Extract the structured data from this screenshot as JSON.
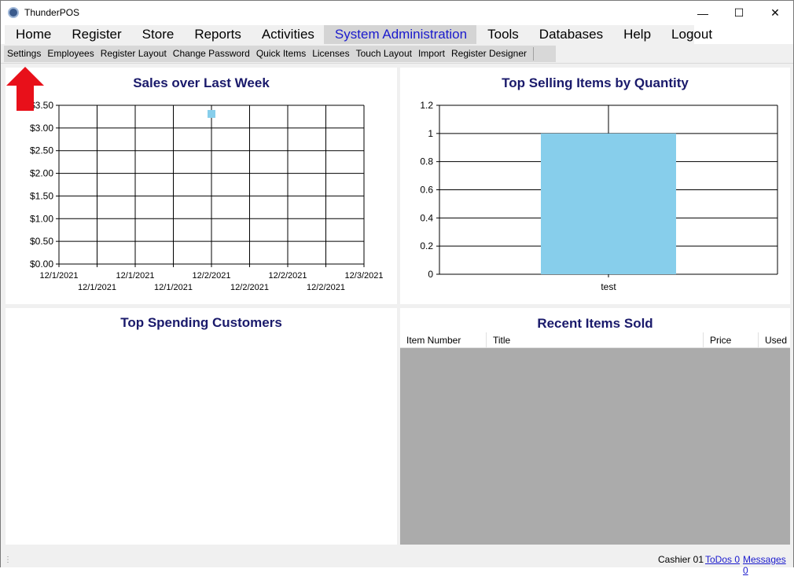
{
  "window": {
    "title": "ThunderPOS",
    "minimize": "—",
    "maximize": "☐",
    "close": "✕"
  },
  "menubar": {
    "items": [
      {
        "label": "Home"
      },
      {
        "label": "Register"
      },
      {
        "label": "Store"
      },
      {
        "label": "Reports"
      },
      {
        "label": "Activities"
      },
      {
        "label": "System Administration",
        "active": true
      },
      {
        "label": "Tools"
      },
      {
        "label": "Databases"
      },
      {
        "label": "Help"
      },
      {
        "label": "Logout"
      }
    ]
  },
  "toolbar": {
    "items": [
      {
        "label": "Settings"
      },
      {
        "label": "Employees"
      },
      {
        "label": "Register Layout"
      },
      {
        "label": "Change Password"
      },
      {
        "label": "Quick Items"
      },
      {
        "label": "Licenses"
      },
      {
        "label": "Touch Layout"
      },
      {
        "label": "Import"
      },
      {
        "label": "Register Designer"
      }
    ]
  },
  "sales_panel": {
    "title": "Sales over Last Week"
  },
  "top_items_panel": {
    "title": "Top Selling Items by Quantity"
  },
  "customers_panel": {
    "title": "Top Spending Customers"
  },
  "recent_panel": {
    "title": "Recent Items Sold",
    "columns": [
      "Item Number",
      "Title",
      "Price",
      "Used"
    ]
  },
  "statusbar": {
    "grip": "⋮",
    "cashier": "Cashier 01",
    "todos": "ToDos 0",
    "messages": "Messages 0"
  },
  "annotation": {
    "arrow_color": "#e8101a"
  },
  "chart_data": [
    {
      "type": "scatter",
      "title": "Sales over Last Week",
      "x_tick_labels": [
        "12/1/2021",
        "12/1/2021",
        "12/1/2021",
        "12/1/2021",
        "12/2/2021",
        "12/2/2021",
        "12/2/2021",
        "12/2/2021",
        "12/3/2021"
      ],
      "y_tick_labels": [
        "$0.00",
        "$0.50",
        "$1.00",
        "$1.50",
        "$2.00",
        "$2.50",
        "$3.00",
        "$3.50"
      ],
      "ylim": [
        0,
        3.5
      ],
      "x_index_range": [
        0,
        8
      ],
      "points": [
        {
          "x_index": 4,
          "y": 3.31
        }
      ],
      "marker_color": "#87ceeb",
      "grid": true
    },
    {
      "type": "bar",
      "title": "Top Selling Items by Quantity",
      "categories": [
        "test"
      ],
      "values": [
        1
      ],
      "ylim": [
        0,
        1.2
      ],
      "y_tick_labels": [
        "0",
        "0.2",
        "0.4",
        "0.6",
        "0.8",
        "1",
        "1.2"
      ],
      "bar_color": "#87ceeb",
      "grid": true
    }
  ]
}
